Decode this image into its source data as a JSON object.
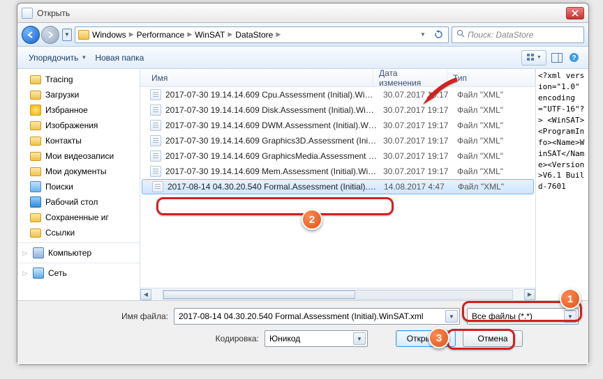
{
  "window": {
    "title": "Открыть",
    "close_tooltip": "Закрыть"
  },
  "address": {
    "crumbs": [
      "Windows",
      "Performance",
      "WinSAT",
      "DataStore"
    ],
    "search_placeholder": "Поиск: DataStore"
  },
  "toolbar": {
    "organize": "Упорядочить",
    "newfolder": "Новая папка"
  },
  "tree": {
    "items": [
      {
        "label": "Tracing",
        "icon": "folder"
      },
      {
        "label": "Загрузки",
        "icon": "folder"
      },
      {
        "label": "Избранное",
        "icon": "star"
      },
      {
        "label": "Изображения",
        "icon": "folder"
      },
      {
        "label": "Контакты",
        "icon": "folder"
      },
      {
        "label": "Мои видеозаписи",
        "icon": "folder"
      },
      {
        "label": "Мои документы",
        "icon": "folder"
      },
      {
        "label": "Поиски",
        "icon": "search"
      },
      {
        "label": "Рабочий стол",
        "icon": "desktop"
      },
      {
        "label": "Сохраненные иг",
        "icon": "folder"
      },
      {
        "label": "Ссылки",
        "icon": "folder"
      }
    ],
    "computer": "Компьютер",
    "network": "Сеть"
  },
  "columns": {
    "name": "Имя",
    "date": "Дата изменения",
    "type": "Тип"
  },
  "files": [
    {
      "name": "2017-07-30 19.14.14.609 Cpu.Assessment (Initial).WinS…",
      "date": "30.07.2017 19:17",
      "type": "Файл \"XML\""
    },
    {
      "name": "2017-07-30 19.14.14.609 Disk.Assessment (Initial).Win…",
      "date": "30.07.2017 19:17",
      "type": "Файл \"XML\""
    },
    {
      "name": "2017-07-30 19.14.14.609 DWM.Assessment (Initial).Wi…",
      "date": "30.07.2017 19:17",
      "type": "Файл \"XML\""
    },
    {
      "name": "2017-07-30 19.14.14.609 Graphics3D.Assessment (Initi…",
      "date": "30.07.2017 19:17",
      "type": "Файл \"XML\""
    },
    {
      "name": "2017-07-30 19.14.14.609 GraphicsMedia.Assessment (In…",
      "date": "30.07.2017 19:17",
      "type": "Файл \"XML\""
    },
    {
      "name": "2017-07-30 19.14.14.609 Mem.Assessment (Initial).Wi…",
      "date": "30.07.2017 19:17",
      "type": "Файл \"XML\""
    },
    {
      "name": "2017-08-14 04.30.20.540 Formal.Assessment (Initial).W…",
      "date": "14.08.2017 4:47",
      "type": "Файл \"XML\"",
      "selected": true
    }
  ],
  "preview_text": "<?xml version=\"1.0\" encoding=\"UTF-16\"?>\n<WinSAT><ProgramInfo><Name>WinSAT</Name><Version>V6.1 Build-7601",
  "bottom": {
    "filename_label": "Имя файла:",
    "filename_value": "2017-08-14 04.30.20.540 Formal.Assessment (Initial).WinSAT.xml",
    "filetype_value": "Все файлы (*.*)",
    "encoding_label": "Кодировка:",
    "encoding_value": "Юникод",
    "open": "Открыть",
    "cancel": "Отмена"
  },
  "annotations": {
    "n1": "1",
    "n2": "2",
    "n3": "3"
  }
}
